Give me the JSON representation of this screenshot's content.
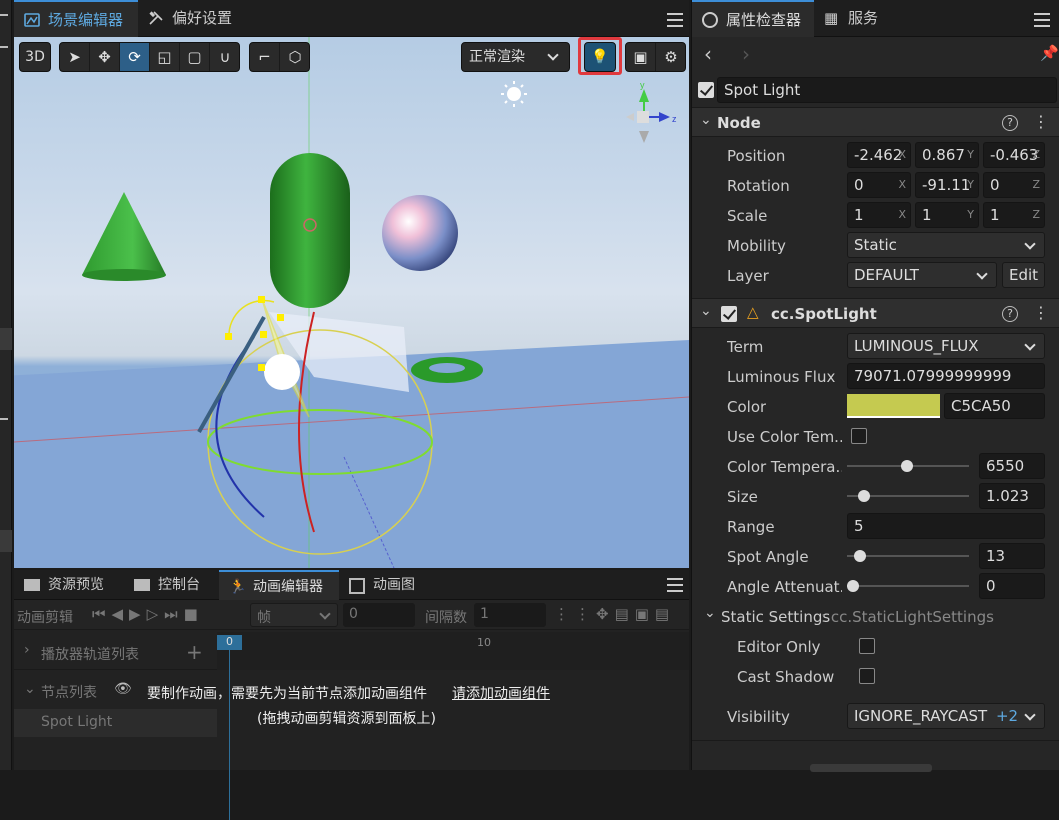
{
  "scene_tabs": [
    {
      "label": "场景编辑器"
    },
    {
      "label": "偏好设置"
    }
  ],
  "toolbar": {
    "mode_3d": "3D",
    "render_mode": "正常渲染"
  },
  "bottom_tabs": [
    {
      "label": "资源预览"
    },
    {
      "label": "控制台"
    },
    {
      "label": "动画编辑器"
    },
    {
      "label": "动画图"
    }
  ],
  "anim": {
    "clip_label": "动画剪辑",
    "frame_unit": "帧",
    "frame_value": "0",
    "interval_label": "间隔数",
    "interval_value": "1",
    "timeline_mark_0": "0",
    "timeline_mark_10": "10",
    "player_tracks": "播放器轨道列表",
    "node_list": "节点列表",
    "node_item": "Spot Light",
    "hint": "要制作动画，需要先为当前节点添加动画组件",
    "hint_link": "请添加动画组件",
    "hint_drag": "(拖拽动画剪辑资源到面板上)"
  },
  "inspector": {
    "tabs": [
      {
        "label": "属性检查器"
      },
      {
        "label": "服务"
      }
    ],
    "node_name": "Spot Light",
    "node_section": "Node",
    "position": {
      "label": "Position",
      "x": "-2.462",
      "y": "0.867",
      "z": "-0.463"
    },
    "rotation": {
      "label": "Rotation",
      "x": "0",
      "y": "-91.11",
      "z": "0"
    },
    "scale": {
      "label": "Scale",
      "x": "1",
      "y": "1",
      "z": "1"
    },
    "mobility": {
      "label": "Mobility",
      "value": "Static"
    },
    "layer": {
      "label": "Layer",
      "value": "DEFAULT",
      "edit": "Edit"
    },
    "component": "cc.SpotLight",
    "term": {
      "label": "Term",
      "value": "LUMINOUS_FLUX"
    },
    "luminous_flux": {
      "label": "Luminous Flux",
      "value": "79071.07999999999"
    },
    "color": {
      "label": "Color",
      "hex": "C5CA50",
      "swatch": "#c5ca50"
    },
    "use_color_temp": {
      "label": "Use Color Tem..."
    },
    "color_temperature": {
      "label": "Color Tempera...",
      "value": "6550",
      "fraction": 0.49
    },
    "size": {
      "label": "Size",
      "value": "1.023",
      "fraction": 0.1
    },
    "range": {
      "label": "Range",
      "value": "5"
    },
    "spot_angle": {
      "label": "Spot Angle",
      "value": "13",
      "fraction": 0.06
    },
    "angle_attenuation": {
      "label": "Angle Attenuat...",
      "value": "0",
      "fraction": 0.0
    },
    "static_settings": {
      "label": "Static Settings",
      "type": ": cc.StaticLightSettings"
    },
    "editor_only": {
      "label": "Editor Only"
    },
    "cast_shadow": {
      "label": "Cast Shadow"
    },
    "visibility": {
      "label": "Visibility",
      "value": "IGNORE_RAYCAST",
      "extra": "+2"
    }
  },
  "colors": {
    "accent": "#3d8ed8",
    "highlight": "#e0393e"
  }
}
